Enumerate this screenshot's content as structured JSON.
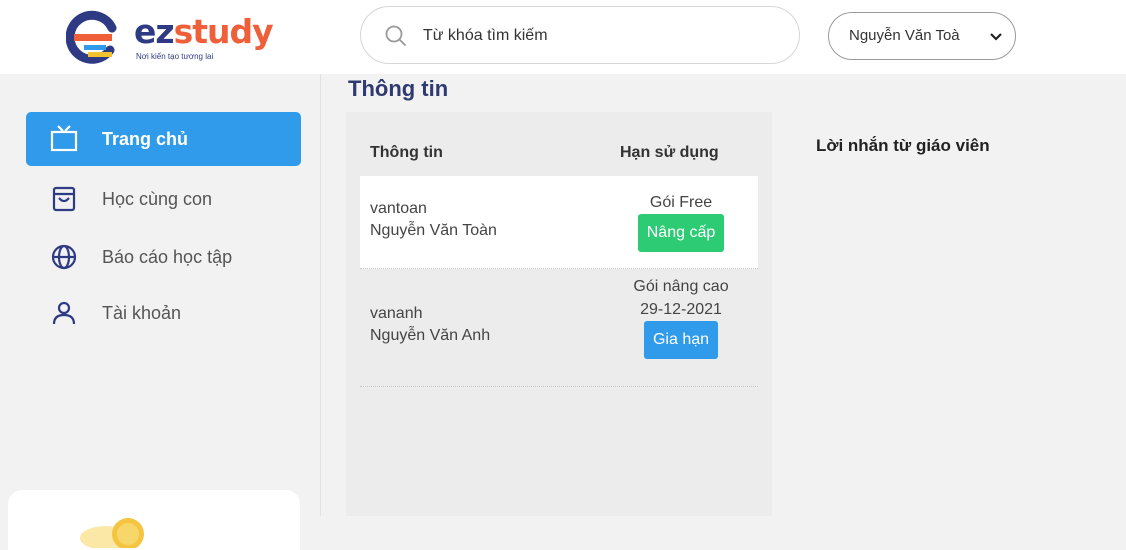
{
  "brand": {
    "name_part1": "ez",
    "name_part2": "study",
    "tagline": "Nơi kiến tạo tương lai",
    "colors": {
      "primary": "#2f3a85",
      "accent": "#ef5f3a",
      "active": "#2f9bea",
      "success": "#2ccb74"
    }
  },
  "header": {
    "search": {
      "placeholder": "Từ khóa tìm kiếm",
      "icon": "search-icon"
    },
    "user_select": {
      "value": "Nguyễn Văn Toà",
      "icon": "chevron-down-icon"
    }
  },
  "sidebar": {
    "items": [
      {
        "label": "Trang chủ",
        "icon": "tv-icon",
        "active": true
      },
      {
        "label": "Học cùng con",
        "icon": "shopping-bag-icon",
        "active": false
      },
      {
        "label": "Báo cáo học tập",
        "icon": "globe-icon",
        "active": false
      },
      {
        "label": "Tài khoản",
        "icon": "user-icon",
        "active": false
      }
    ]
  },
  "main": {
    "title": "Thông tin",
    "table": {
      "headers": [
        "Thông tin",
        "Hạn sử dụng"
      ],
      "rows": [
        {
          "username": "vantoan",
          "fullname": "Nguyễn Văn Toàn",
          "plan": "Gói Free",
          "expiry": "",
          "action": "Nâng cấp"
        },
        {
          "username": "vananh",
          "fullname": "Nguyễn Văn Anh",
          "plan": "Gói nâng cao",
          "expiry": "29-12-2021",
          "action": "Gia hạn"
        }
      ]
    }
  },
  "messages": {
    "title": "Lời nhắn từ giáo viên"
  }
}
